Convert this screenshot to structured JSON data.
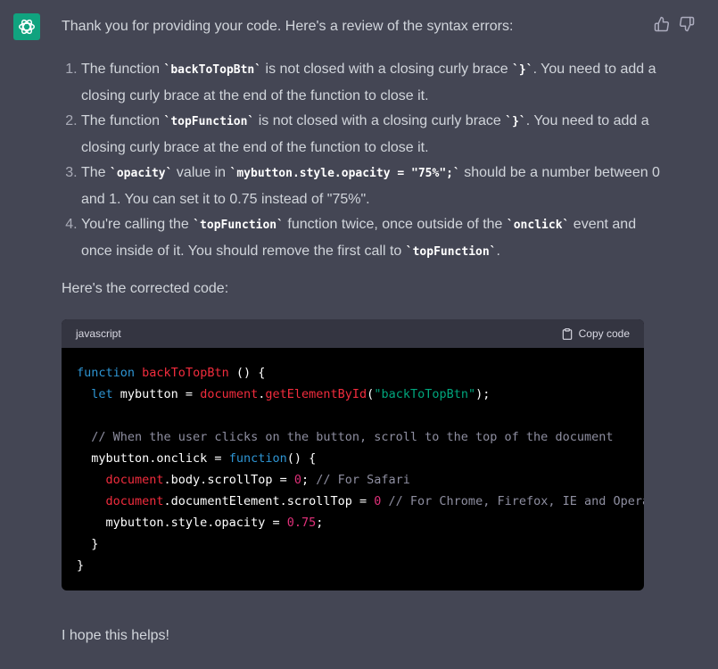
{
  "intro": "Thank you for providing your code. Here's a review of the syntax errors:",
  "errors": [
    {
      "p1": "The function ",
      "c1": "`backToTopBtn`",
      "p2": " is not closed with a closing curly brace ",
      "c2": "`}`",
      "p3": ". You need to add a closing curly brace at the end of the function to close it."
    },
    {
      "p1": "The function ",
      "c1": "`topFunction`",
      "p2": " is not closed with a closing curly brace ",
      "c2": "`}`",
      "p3": ". You need to add a closing curly brace at the end of the function to close it."
    },
    {
      "p1": "The ",
      "c1": "`opacity`",
      "p2": " value in ",
      "c2": "`mybutton.style.opacity = \"75%\";`",
      "p3": " should be a number between 0 and 1. You can set it to 0.75 instead of \"75%\"."
    },
    {
      "p1": "You're calling the ",
      "c1": "`topFunction`",
      "p2": " function twice, once outside of the ",
      "c2": "`onclick`",
      "p3": " event and once inside of it. You should remove the first call to ",
      "c3": "`topFunction`",
      "p4": "."
    }
  ],
  "corrected_intro": "Here's the corrected code:",
  "code_block": {
    "language": "javascript",
    "copy_label": "Copy code",
    "lines": [
      [
        {
          "t": "function",
          "c": "kw"
        },
        {
          "t": " "
        },
        {
          "t": "backToTopBtn",
          "c": "fn"
        },
        {
          "t": " () {"
        }
      ],
      [
        {
          "t": "  "
        },
        {
          "t": "let",
          "c": "kw"
        },
        {
          "t": " mybutton = "
        },
        {
          "t": "document",
          "c": "fn"
        },
        {
          "t": "."
        },
        {
          "t": "getElementById",
          "c": "fn"
        },
        {
          "t": "("
        },
        {
          "t": "\"backToTopBtn\"",
          "c": "st"
        },
        {
          "t": ");"
        }
      ],
      [],
      [
        {
          "t": "  "
        },
        {
          "t": "// When the user clicks on the button, scroll to the top of the document",
          "c": "cm"
        }
      ],
      [
        {
          "t": "  mybutton.onclick = "
        },
        {
          "t": "function",
          "c": "kw"
        },
        {
          "t": "() {"
        }
      ],
      [
        {
          "t": "    "
        },
        {
          "t": "document",
          "c": "fn"
        },
        {
          "t": ".body.scrollTop = "
        },
        {
          "t": "0",
          "c": "nm"
        },
        {
          "t": "; "
        },
        {
          "t": "// For Safari",
          "c": "cm"
        }
      ],
      [
        {
          "t": "    "
        },
        {
          "t": "document",
          "c": "fn"
        },
        {
          "t": ".documentElement.scrollTop = "
        },
        {
          "t": "0",
          "c": "nm"
        },
        {
          "t": " "
        },
        {
          "t": "// For Chrome, Firefox, IE and Opera",
          "c": "cm"
        }
      ],
      [
        {
          "t": "    mybutton.style.opacity = "
        },
        {
          "t": "0.75",
          "c": "nm"
        },
        {
          "t": ";"
        }
      ],
      [
        {
          "t": "  }"
        }
      ],
      [
        {
          "t": "}"
        }
      ]
    ]
  },
  "closing": "I hope this helps!",
  "icons": {
    "avatar": "openai-logo-icon",
    "like": "thumbs-up-icon",
    "dislike": "thumbs-down-icon",
    "copy": "clipboard-icon"
  },
  "colors": {
    "background": "#444654",
    "avatar": "#10a37f",
    "code_background": "#000000",
    "code_header": "#343541",
    "keyword": "#2e95d3",
    "function": "#f22c3d",
    "string": "#00a67d",
    "comment": "#8e8ea0",
    "number": "#df3079"
  }
}
